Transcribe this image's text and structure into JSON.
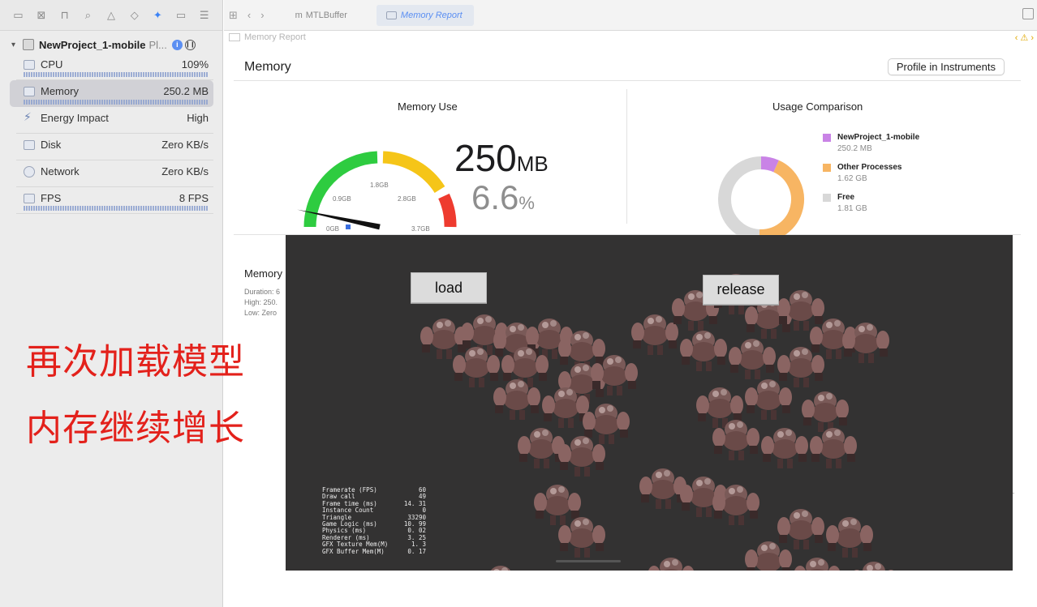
{
  "navigator": {
    "toolbar_icons": [
      "folder-icon",
      "source-control-icon",
      "hierarchy-icon",
      "search-icon",
      "warning-icon",
      "test-icon",
      "debug-icon",
      "breakpoint-icon",
      "report-icon"
    ],
    "process": {
      "name": "NewProject_1-mobile",
      "suffix": "Pl..."
    },
    "gauges": [
      {
        "label": "CPU",
        "value": "109%"
      },
      {
        "label": "Memory",
        "value": "250.2 MB"
      },
      {
        "label": "Energy Impact",
        "value": "High"
      },
      {
        "label": "Disk",
        "value": "Zero KB/s"
      },
      {
        "label": "Network",
        "value": "Zero KB/s"
      },
      {
        "label": "FPS",
        "value": "8 FPS"
      }
    ]
  },
  "tabs": [
    {
      "label": "MTLBuffer"
    },
    {
      "label": "Memory Report"
    }
  ],
  "jumpbar": {
    "label": "Memory Report"
  },
  "report": {
    "title": "Memory",
    "profile_button": "Profile in Instruments",
    "memory_use": {
      "title": "Memory Use",
      "ticks": [
        "0GB",
        "0.9GB",
        "1.8GB",
        "2.8GB",
        "3.7GB"
      ],
      "value": "250",
      "unit": "MB",
      "percent": "6.6",
      "percent_unit": "%",
      "gauge_fraction": 0.066
    },
    "usage_comparison": {
      "title": "Usage Comparison",
      "items": [
        {
          "name": "NewProject_1-mobile",
          "size": "250.2 MB",
          "color": "#c983e6",
          "gb": 0.25
        },
        {
          "name": "Other Processes",
          "size": "1.62 GB",
          "color": "#f7b563",
          "gb": 1.62
        },
        {
          "name": "Free",
          "size": "1.81 GB",
          "color": "#d8d8d8",
          "gb": 1.81
        }
      ]
    },
    "lower": {
      "title": "Memory",
      "meta": [
        "Duration: 6",
        "High: 250.",
        "Low: Zero"
      ]
    }
  },
  "game": {
    "load_button": "load",
    "release_button": "release",
    "stats": [
      {
        "k": "Framerate (FPS)",
        "v": "60"
      },
      {
        "k": "Draw call",
        "v": "49"
      },
      {
        "k": "Frame time (ms)",
        "v": "14. 31"
      },
      {
        "k": "Instance Count",
        "v": "0"
      },
      {
        "k": "Triangle",
        "v": "33290"
      },
      {
        "k": "Game Logic (ms)",
        "v": "10. 99"
      },
      {
        "k": "Physics (ms)",
        "v": "0. 02"
      },
      {
        "k": "Renderer (ms)",
        "v": "3. 25"
      },
      {
        "k": "GFX Texture Mem(M)",
        "v": "1. 3"
      },
      {
        "k": "GFX Buffer Mem(M)",
        "v": "0. 17"
      }
    ]
  },
  "annotations": [
    "再次加载模型",
    "内存继续增长"
  ]
}
